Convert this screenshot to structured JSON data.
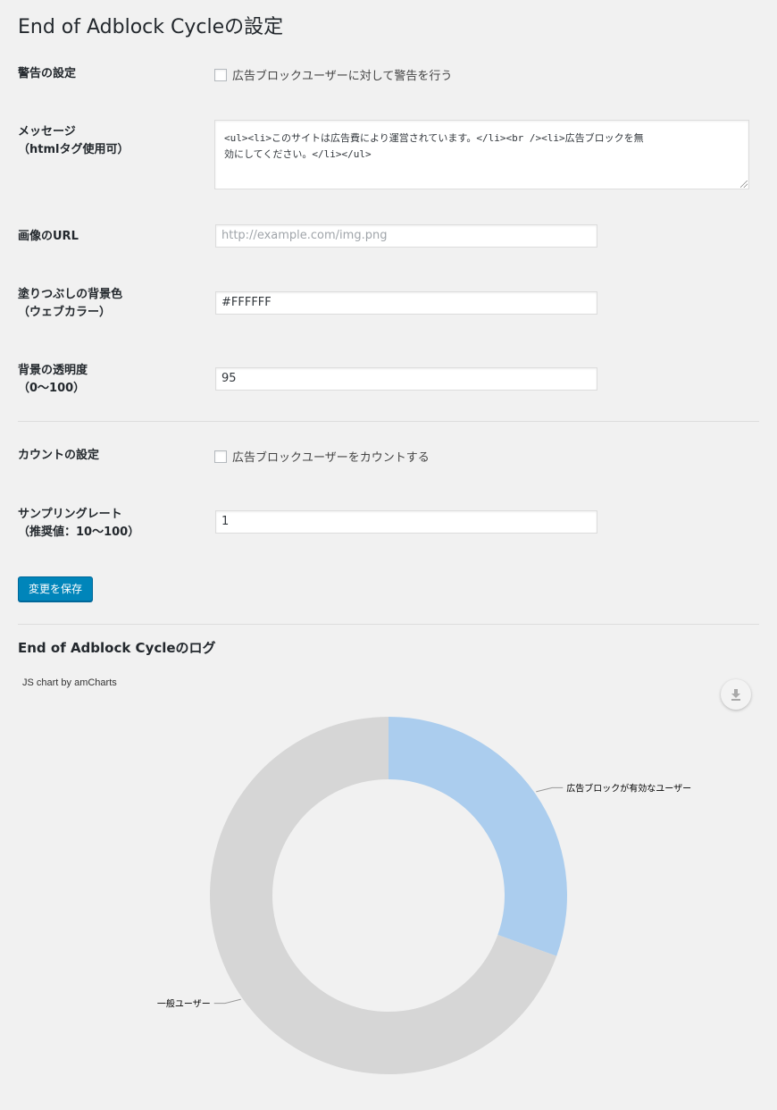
{
  "page": {
    "title": "End of Adblock Cycleの設定"
  },
  "settings": {
    "warning": {
      "label": "警告の設定",
      "checkbox_label": "広告ブロックユーザーに対して警告を行う",
      "checked": false
    },
    "message": {
      "label_line1": "メッセージ",
      "label_line2": "（htmlタグ使用可）",
      "value_line1": "<ul><li>このサイトは広告費により運営されています。</li><br /><li>広告ブロックを無",
      "value_line2": "効にしてください。</li></ul>"
    },
    "image_url": {
      "label": "画像のURL",
      "placeholder": "http://example.com/img.png"
    },
    "bg_color": {
      "label_line1": "塗りつぶしの背景色",
      "label_line2": "（ウェブカラー）",
      "value": "#FFFFFF"
    },
    "opacity": {
      "label_line1": "背景の透明度",
      "label_line2": "（0〜100）",
      "value": "95"
    },
    "count": {
      "label": "カウントの設定",
      "checkbox_label": "広告ブロックユーザーをカウントする",
      "checked": false
    },
    "sampling": {
      "label_line1": "サンプリングレート",
      "label_line2": "（推奨値：10〜100）",
      "value": "1"
    },
    "save_label": "変更を保存"
  },
  "log": {
    "title": "End of Adblock Cycleのログ",
    "credit": "JS chart by amCharts",
    "download_icon": "download-icon"
  },
  "chart_data": {
    "type": "pie",
    "donut": true,
    "categories": [
      "広告ブロックが有効なユーザー",
      "一般ユーザー"
    ],
    "values": [
      30.5,
      69.5
    ],
    "colors": [
      "#abcdee",
      "#d6d6d6"
    ]
  }
}
